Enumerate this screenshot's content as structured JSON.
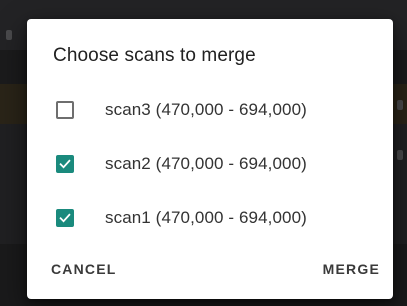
{
  "dialog": {
    "title": "Choose scans to merge",
    "scans": [
      {
        "label": "scan3 (470,000 - 694,000)",
        "checked": false
      },
      {
        "label": "scan2 (470,000 - 694,000)",
        "checked": true
      },
      {
        "label": "scan1 (470,000 - 694,000)",
        "checked": true
      }
    ],
    "cancel_label": "CANCEL",
    "merge_label": "MERGE"
  },
  "colors": {
    "accent": "#1a8a7d",
    "dialog_bg": "#ffffff",
    "backdrop": "#1b1b1c"
  },
  "icons": {
    "checked": "checkmark-icon"
  }
}
